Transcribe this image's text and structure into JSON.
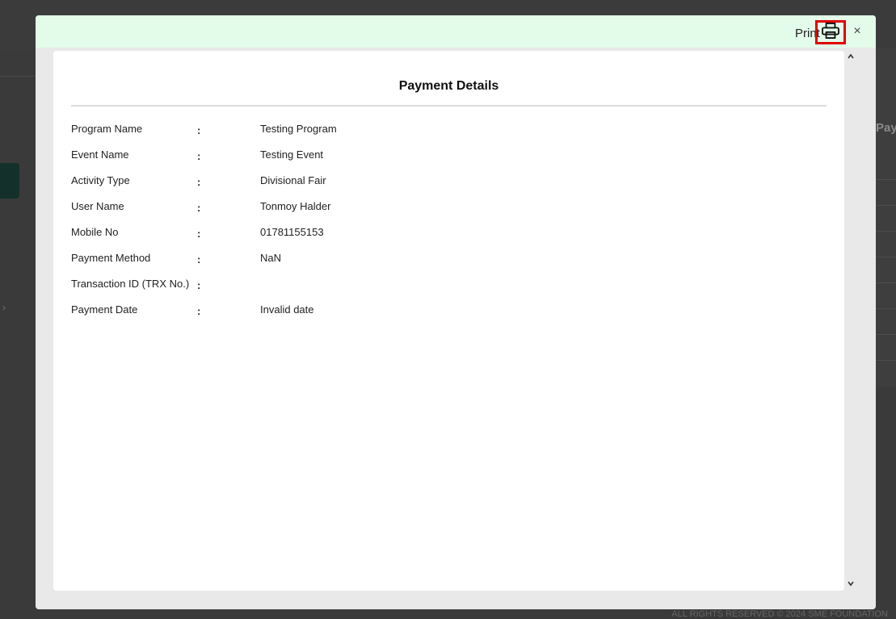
{
  "background": {
    "column_header_fragment": "Pay",
    "footer_text": "ALL RIGHTS RESERVED © 2024 SME FOUNDATION"
  },
  "modal": {
    "print_label": "Print",
    "close_symbol": "×",
    "title": "Payment Details",
    "separator": ":",
    "fields": [
      {
        "label": "Program Name",
        "value": "Testing Program"
      },
      {
        "label": "Event Name",
        "value": "Testing Event"
      },
      {
        "label": "Activity Type",
        "value": "Divisional Fair"
      },
      {
        "label": "User Name",
        "value": "Tonmoy Halder"
      },
      {
        "label": "Mobile No",
        "value": "01781155153"
      },
      {
        "label": "Payment Method",
        "value": "NaN"
      },
      {
        "label": "Transaction ID (TRX No.)",
        "value": ""
      },
      {
        "label": "Payment Date",
        "value": "Invalid date"
      }
    ]
  },
  "icons": {
    "print": "printer-icon",
    "close": "close-icon",
    "scroll_up": "chevron-up-icon",
    "scroll_down": "chevron-down-icon"
  },
  "colors": {
    "header_bg": "#e3fbe9",
    "highlight_border": "#e10000",
    "overlay_bg": "#3a3a3a"
  }
}
